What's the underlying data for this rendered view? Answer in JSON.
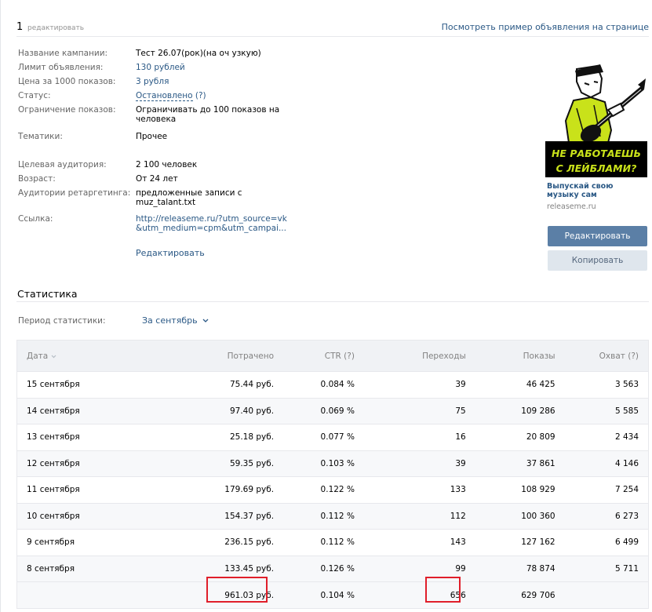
{
  "header": {
    "number": "1",
    "edit_label": "редактировать",
    "preview_link": "Посмотреть пример объявления на странице"
  },
  "campaign": {
    "rows": [
      {
        "label": "Название кампании:",
        "value": "Тест 26.07(рок)(на оч узкую)"
      },
      {
        "label": "Лимит объявления:",
        "value": "130 рублей"
      },
      {
        "label": "Цена за 1000 показов:",
        "value": "3 рубля"
      },
      {
        "label": "Статус:",
        "value": "Остановлено",
        "hint": "(?)"
      },
      {
        "label": "Ограничение показов:",
        "value": "Ограничивать до 100 показов на человека"
      },
      {
        "label": "Тематики:",
        "value": "Прочее"
      },
      {
        "label": "Целевая аудитория:",
        "value": "2 100 человек"
      },
      {
        "label": "Возраст:",
        "value": "От 24 лет"
      },
      {
        "label": "Аудитории ретаргетинга:",
        "value": "предложенные записи с muz_talant.txt"
      },
      {
        "label": "Ссылка:",
        "value": "http://releaseme.ru/?utm_source=vk&utm_medium=cpm&utm_campai..."
      }
    ],
    "edit_link": "Редактировать"
  },
  "ad": {
    "banner_line1": "НЕ РАБОТАЕШЬ",
    "banner_line2": "С ЛЕЙБЛАМИ?",
    "title": "Выпускай свою музыку сам",
    "domain": "releaseme.ru",
    "edit_button": "Редактировать",
    "copy_button": "Копировать"
  },
  "stats": {
    "title": "Статистика",
    "period_label": "Период статистики:",
    "period_value": "За сентябрь",
    "columns": [
      "Дата",
      "Потрачено",
      "CTR (?)",
      "Переходы",
      "Показы",
      "Охват (?)"
    ],
    "rows": [
      [
        "15 сентября",
        "75.44 руб.",
        "0.084 %",
        "39",
        "46 425",
        "3 563"
      ],
      [
        "14 сентября",
        "97.40 руб.",
        "0.069 %",
        "75",
        "109 286",
        "5 585"
      ],
      [
        "13 сентября",
        "25.18 руб.",
        "0.077 %",
        "16",
        "20 809",
        "2 434"
      ],
      [
        "12 сентября",
        "59.35 руб.",
        "0.103 %",
        "39",
        "37 861",
        "4 146"
      ],
      [
        "11 сентября",
        "179.69 руб.",
        "0.122 %",
        "133",
        "108 929",
        "7 254"
      ],
      [
        "10 сентября",
        "154.37 руб.",
        "0.112 %",
        "112",
        "100 360",
        "6 273"
      ],
      [
        "9 сентября",
        "236.15 руб.",
        "0.112 %",
        "143",
        "127 162",
        "6 499"
      ],
      [
        "8 сентября",
        "133.45 руб.",
        "0.126 %",
        "99",
        "78 874",
        "5 711"
      ]
    ],
    "total": [
      "",
      "961.03 руб.",
      "0.104 %",
      "656",
      "629 706",
      ""
    ]
  },
  "colors": {
    "link": "#2a5885",
    "primary_button": "#5b7fa6",
    "highlight": "#e01e2a"
  }
}
